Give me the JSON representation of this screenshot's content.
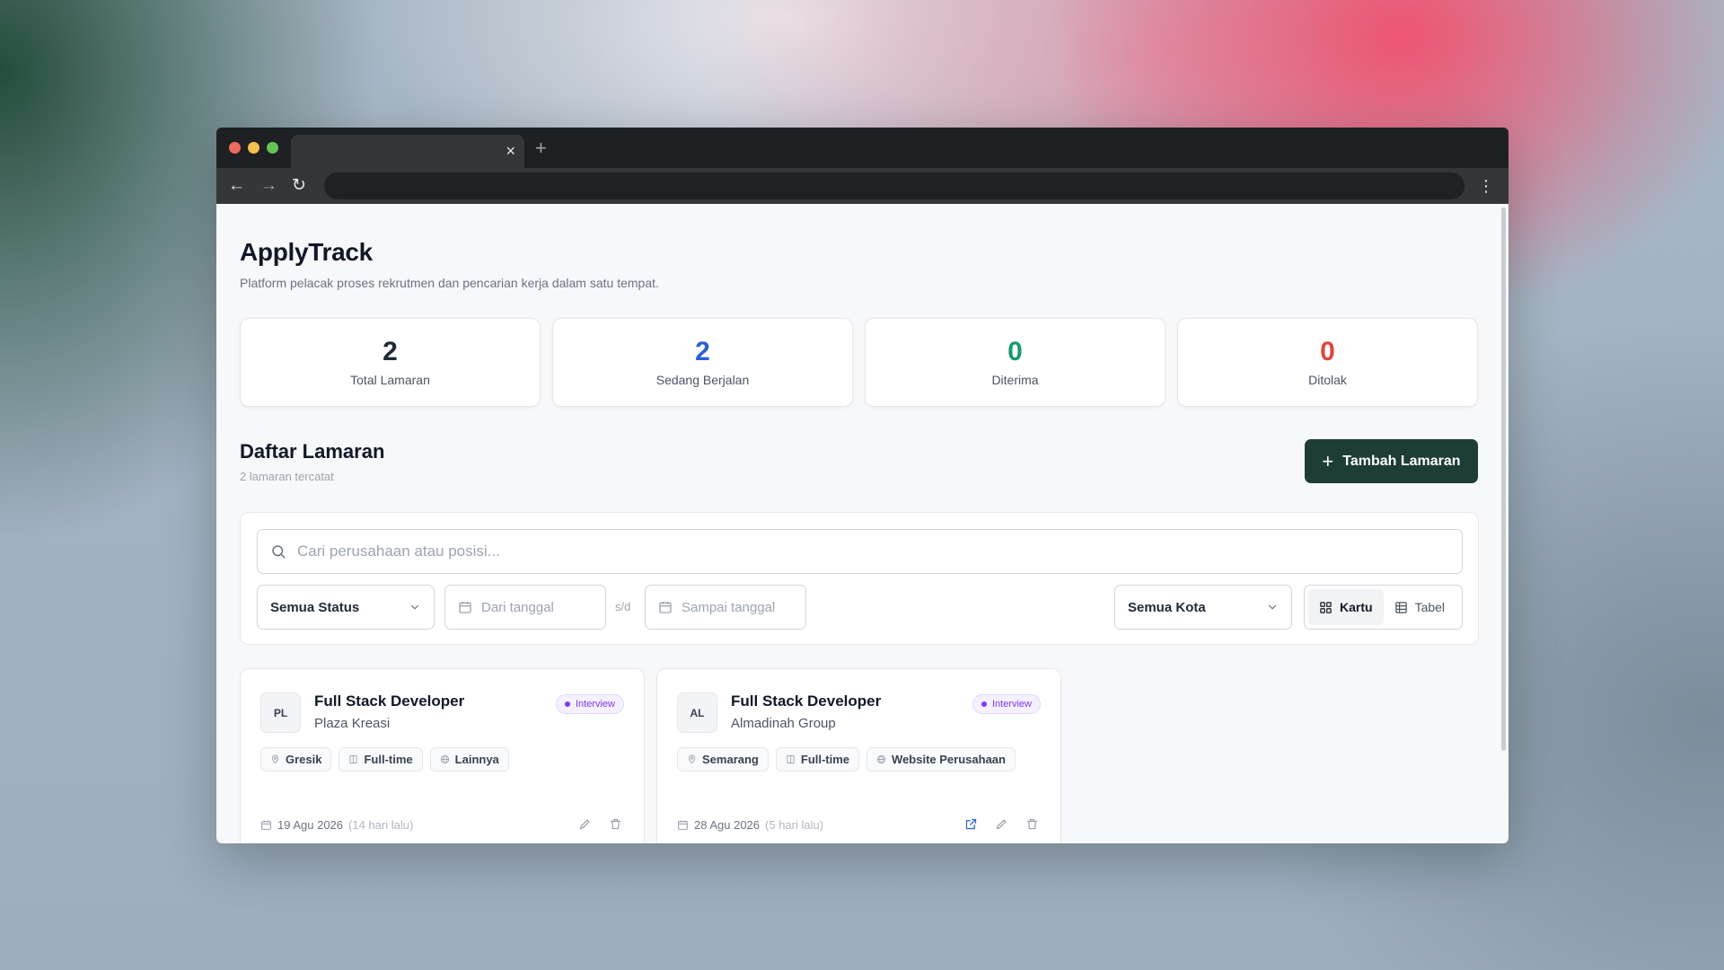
{
  "browser": {
    "tab_close": "×",
    "tab_new": "+",
    "back": "←",
    "forward": "→",
    "reload": "↻",
    "menu": "⋮"
  },
  "app": {
    "title": "ApplyTrack",
    "subtitle": "Platform pelacak proses rekrutmen dan pencarian kerja dalam satu tempat."
  },
  "stats": [
    {
      "value": "2",
      "label": "Total Lamaran",
      "color": "#1f2937"
    },
    {
      "value": "2",
      "label": "Sedang Berjalan",
      "color": "#2b5fd9"
    },
    {
      "value": "0",
      "label": "Diterima",
      "color": "#1a9a6c"
    },
    {
      "value": "0",
      "label": "Ditolak",
      "color": "#e0443c"
    }
  ],
  "section": {
    "title": "Daftar Lamaran",
    "subtitle": "2 lamaran tercatat",
    "add_button": "Tambah Lamaran",
    "add_icon": "+"
  },
  "filters": {
    "search_placeholder": "Cari perusahaan atau posisi...",
    "status": "Semua Status",
    "from_date_placeholder": "Dari tanggal",
    "range_separator": "s/d",
    "to_date_placeholder": "Sampai tanggal",
    "city": "Semua Kota",
    "view_card": "Kartu",
    "view_table": "Tabel"
  },
  "applications": [
    {
      "initials": "PL",
      "title": "Full Stack Developer",
      "company": "Plaza Kreasi",
      "status": "Interview",
      "tags": [
        "Gresik",
        "Full-time",
        "Lainnya"
      ],
      "date": "19 Agu 2026",
      "relative": "(14 hari lalu)"
    },
    {
      "initials": "AL",
      "title": "Full Stack Developer",
      "company": "Almadinah Group",
      "status": "Interview",
      "tags": [
        "Semarang",
        "Full-time",
        "Website Perusahaan"
      ],
      "date": "28 Agu 2026",
      "relative": "(5 hari lalu)"
    }
  ],
  "colors": {
    "accent": "#1e3d34",
    "status_interview": "#7c3aed"
  }
}
